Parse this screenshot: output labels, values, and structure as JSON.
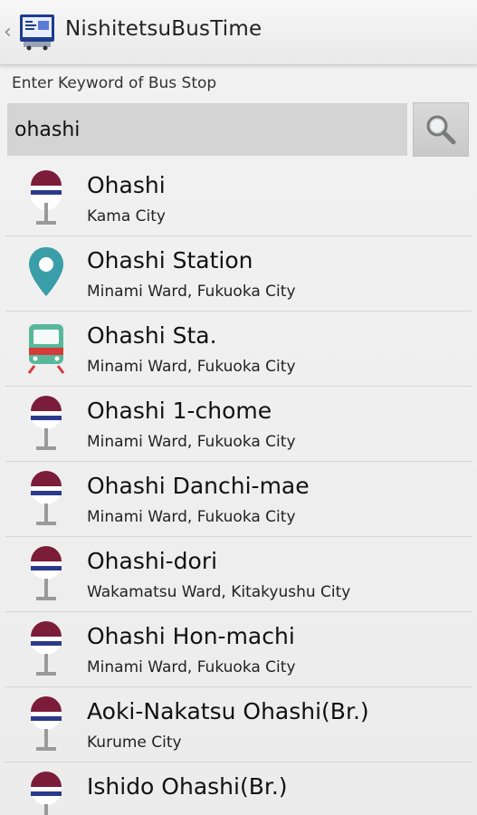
{
  "app": {
    "title": "NishitetsuBusTime",
    "icon": "bus-timetable-app-icon"
  },
  "search": {
    "label": "Enter Keyword of Bus Stop",
    "value": "ohashi",
    "button_icon": "search-icon"
  },
  "results": [
    {
      "name": "Ohashi",
      "area": "Kama City",
      "icon": "bus-stop-icon"
    },
    {
      "name": "Ohashi Station",
      "area": "Minami Ward, Fukuoka City",
      "icon": "map-pin-icon"
    },
    {
      "name": "Ohashi Sta.",
      "area": "Minami Ward, Fukuoka City",
      "icon": "train-icon"
    },
    {
      "name": "Ohashi 1-chome",
      "area": "Minami Ward, Fukuoka City",
      "icon": "bus-stop-icon"
    },
    {
      "name": "Ohashi Danchi-mae",
      "area": "Minami Ward, Fukuoka City",
      "icon": "bus-stop-icon"
    },
    {
      "name": "Ohashi-dori",
      "area": "Wakamatsu Ward, Kitakyushu City",
      "icon": "bus-stop-icon"
    },
    {
      "name": "Ohashi Hon-machi",
      "area": "Minami Ward, Fukuoka City",
      "icon": "bus-stop-icon"
    },
    {
      "name": "Aoki-Nakatsu Ohashi(Br.)",
      "area": "Kurume City",
      "icon": "bus-stop-icon"
    },
    {
      "name": "Ishido Ohashi(Br.)",
      "area": "",
      "icon": "bus-stop-icon"
    }
  ],
  "colors": {
    "bus_stop_red": "#7b1c3a",
    "bus_stop_blue": "#2c3a8c",
    "pin_teal": "#3a9ea8",
    "train_green": "#58b89a",
    "train_red": "#d43a3a"
  }
}
